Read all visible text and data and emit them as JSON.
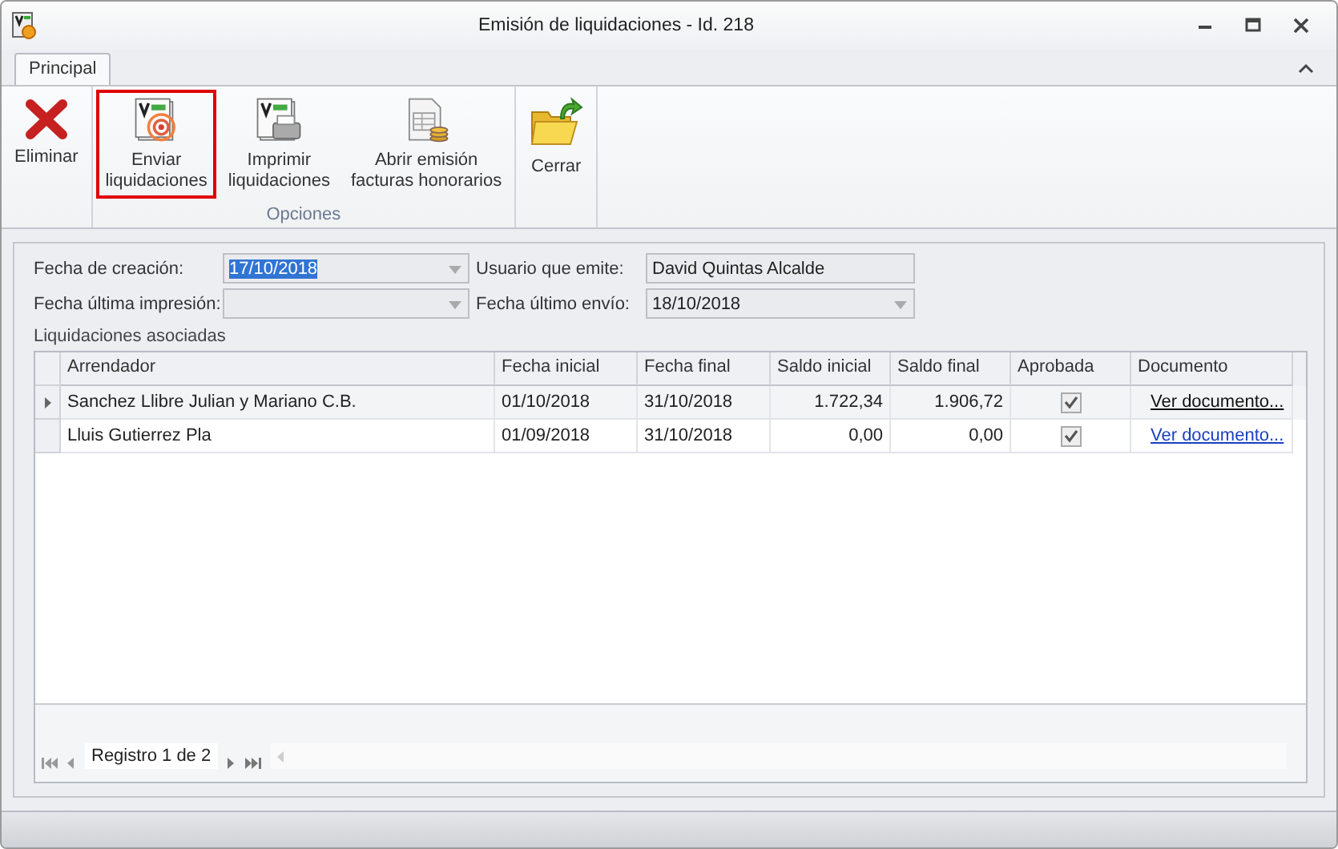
{
  "window": {
    "title": "Emisión de liquidaciones - Id. 218"
  },
  "tabs": [
    {
      "label": "Principal",
      "selected": true
    }
  ],
  "ribbon_groups": [
    {
      "buttons": [
        {
          "kind": "delete",
          "label": "Eliminar",
          "highlighted": false
        }
      ]
    },
    {
      "label": "Opciones",
      "buttons": [
        {
          "kind": "send",
          "label": "Enviar\nliquidaciones",
          "highlighted": true
        },
        {
          "kind": "print",
          "label": "Imprimir\nliquidaciones",
          "highlighted": false
        },
        {
          "kind": "invoice",
          "label": "Abrir emisión\nfacturas honorarios",
          "highlighted": false
        }
      ]
    },
    {
      "buttons": [
        {
          "kind": "close",
          "label": "Cerrar",
          "highlighted": false
        }
      ]
    }
  ],
  "fields": [
    {
      "label": "Fecha de creación:",
      "value": "17/10/2018",
      "kind": "combo",
      "text_selected": true,
      "disabled": true
    },
    {
      "label": "Usuario que emite:",
      "value": "David Quintas Alcalde",
      "kind": "text",
      "disabled": true
    },
    {
      "label": "Fecha última impresión:",
      "kind": "combo",
      "disabled": true
    },
    {
      "label": "Fecha último envío:",
      "value": "18/10/2018",
      "kind": "combo",
      "disabled": true
    }
  ],
  "grid": {
    "title": "Liquidaciones asociadas",
    "columns": [
      "Arrendador",
      "Fecha inicial",
      "Fecha final",
      "Saldo inicial",
      "Saldo final",
      "Aprobada",
      "Documento"
    ],
    "rows": [
      {
        "selected": true,
        "arrendador": "Sanchez Llibre Julian y Mariano C.B.",
        "fecha_inicial": "01/10/2018",
        "fecha_final": "31/10/2018",
        "saldo_inicial": "1.722,34",
        "saldo_final": "1.906,72",
        "aprobada": true,
        "documento": "Ver documento..."
      },
      {
        "selected": false,
        "arrendador": "Lluis Gutierrez Pla",
        "fecha_inicial": "01/09/2018",
        "fecha_final": "31/10/2018",
        "saldo_inicial": "0,00",
        "saldo_final": "0,00",
        "aprobada": true,
        "documento": "Ver documento..."
      }
    ],
    "navigator": "Registro 1 de 2"
  }
}
